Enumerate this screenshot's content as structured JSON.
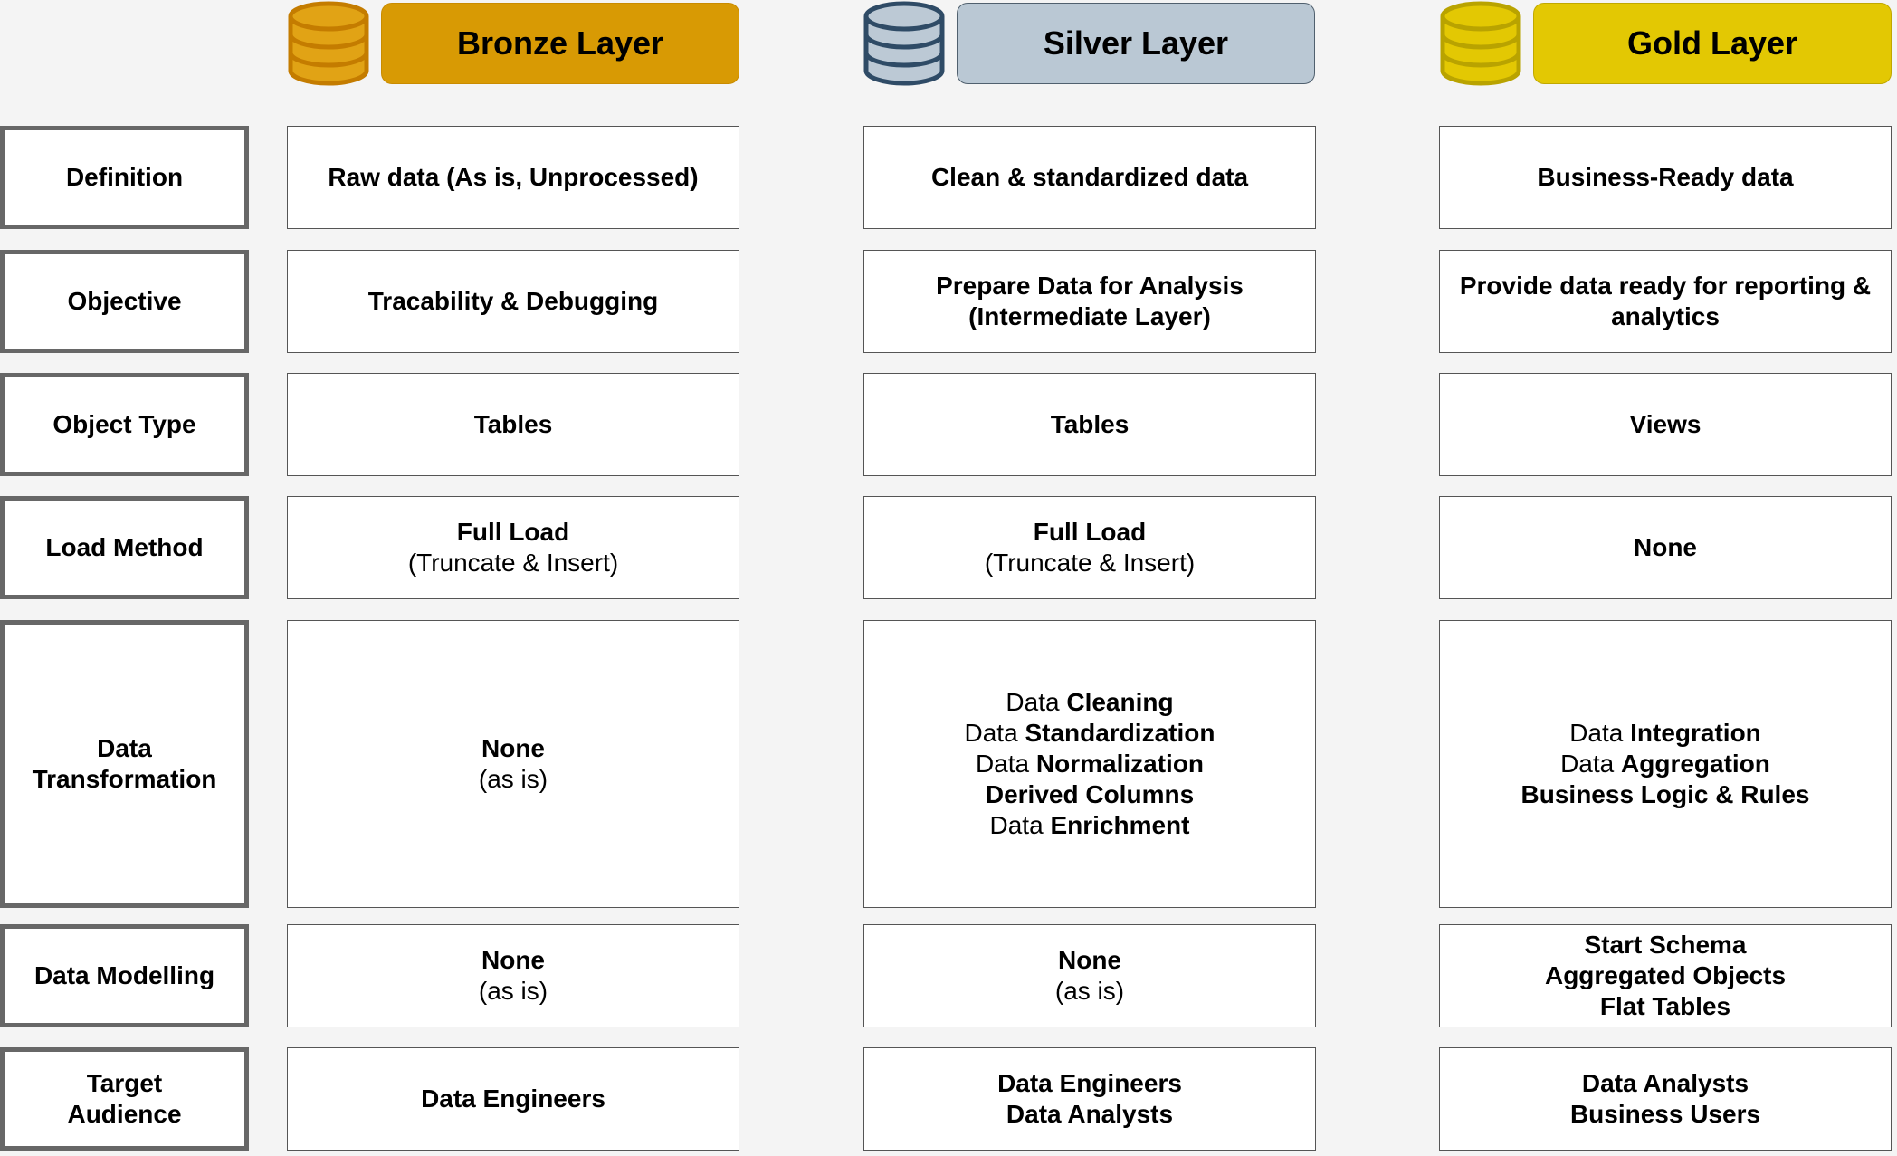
{
  "layers": [
    {
      "key": "bronze",
      "title": "Bronze Layer",
      "icon": "database-icon",
      "color": "#d89a04"
    },
    {
      "key": "silver",
      "title": "Silver Layer",
      "icon": "database-icon",
      "color": "#2f4b66"
    },
    {
      "key": "gold",
      "title": "Gold Layer",
      "icon": "database-icon",
      "color": "#e3c803"
    }
  ],
  "rows": [
    {
      "label": "Definition",
      "cells": [
        [
          [
            {
              "t": "Raw data (As is, Unprocessed)",
              "b": true
            }
          ]
        ],
        [
          [
            {
              "t": "Clean & standardized data",
              "b": true
            }
          ]
        ],
        [
          [
            {
              "t": "Business-Ready data",
              "b": true
            }
          ]
        ]
      ]
    },
    {
      "label": "Objective",
      "cells": [
        [
          [
            {
              "t": "Tracability & Debugging",
              "b": true
            }
          ]
        ],
        [
          [
            {
              "t": "Prepare Data for Analysis",
              "b": true
            }
          ],
          [
            {
              "t": "(Intermediate Layer)",
              "b": true
            }
          ]
        ],
        [
          [
            {
              "t": "Provide data ready for reporting &",
              "b": true
            }
          ],
          [
            {
              "t": "analytics",
              "b": true
            }
          ]
        ]
      ]
    },
    {
      "label": "Object Type",
      "cells": [
        [
          [
            {
              "t": "Tables",
              "b": true
            }
          ]
        ],
        [
          [
            {
              "t": "Tables",
              "b": true
            }
          ]
        ],
        [
          [
            {
              "t": "Views",
              "b": true
            }
          ]
        ]
      ]
    },
    {
      "label": "Load Method",
      "cells": [
        [
          [
            {
              "t": "Full Load",
              "b": true
            }
          ],
          [
            {
              "t": "(Truncate & Insert)",
              "b": false
            }
          ]
        ],
        [
          [
            {
              "t": "Full Load",
              "b": true
            }
          ],
          [
            {
              "t": "(Truncate & Insert)",
              "b": false
            }
          ]
        ],
        [
          [
            {
              "t": "None",
              "b": true
            }
          ]
        ]
      ]
    },
    {
      "label": "Data Transformation",
      "cells": [
        [
          [
            {
              "t": "None",
              "b": true
            }
          ],
          [
            {
              "t": "(as is)",
              "b": false
            }
          ]
        ],
        [
          [
            {
              "t": "Data ",
              "b": false
            },
            {
              "t": "Cleaning",
              "b": true
            }
          ],
          [
            {
              "t": "Data ",
              "b": false
            },
            {
              "t": "Standardization",
              "b": true
            }
          ],
          [
            {
              "t": "Data ",
              "b": false
            },
            {
              "t": "Normalization",
              "b": true
            }
          ],
          [
            {
              "t": "Derived Columns",
              "b": true
            }
          ],
          [
            {
              "t": "Data ",
              "b": false
            },
            {
              "t": "Enrichment",
              "b": true
            }
          ]
        ],
        [
          [
            {
              "t": "Data ",
              "b": false
            },
            {
              "t": "Integration",
              "b": true
            }
          ],
          [
            {
              "t": "Data ",
              "b": false
            },
            {
              "t": "Aggregation",
              "b": true
            }
          ],
          [
            {
              "t": "Business Logic & Rules",
              "b": true
            }
          ]
        ]
      ]
    },
    {
      "label": "Data Modelling",
      "cells": [
        [
          [
            {
              "t": "None",
              "b": true
            }
          ],
          [
            {
              "t": "(as is)",
              "b": false
            }
          ]
        ],
        [
          [
            {
              "t": "None",
              "b": true
            }
          ],
          [
            {
              "t": "(as is)",
              "b": false
            }
          ]
        ],
        [
          [
            {
              "t": "Start Schema",
              "b": true
            }
          ],
          [
            {
              "t": "Aggregated Objects",
              "b": true
            }
          ],
          [
            {
              "t": "Flat Tables",
              "b": true
            }
          ]
        ]
      ]
    },
    {
      "label": "Target Audience",
      "cells": [
        [
          [
            {
              "t": "Data Engineers",
              "b": true
            }
          ]
        ],
        [
          [
            {
              "t": "Data Engineers",
              "b": true
            }
          ],
          [
            {
              "t": "Data Analysts",
              "b": true
            }
          ]
        ],
        [
          [
            {
              "t": "Data Analysts",
              "b": true
            }
          ],
          [
            {
              "t": "Business Users",
              "b": true
            }
          ]
        ]
      ]
    }
  ]
}
